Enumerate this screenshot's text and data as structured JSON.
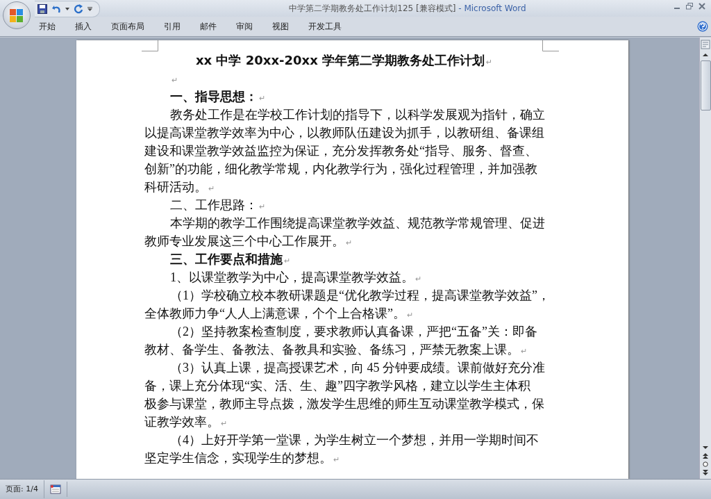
{
  "window": {
    "title_doc": "中学第二学期教务处工作计划125 [兼容模式]",
    "title_app": " - Microsoft Word"
  },
  "tabs": [
    {
      "label": "开始",
      "selected": false
    },
    {
      "label": "插入",
      "selected": false
    },
    {
      "label": "页面布局",
      "selected": false
    },
    {
      "label": "引用",
      "selected": false
    },
    {
      "label": "邮件",
      "selected": false
    },
    {
      "label": "审阅",
      "selected": false
    },
    {
      "label": "视图",
      "selected": false
    },
    {
      "label": "开发工具",
      "selected": false
    }
  ],
  "document": {
    "paragraphs": [
      {
        "kind": "title",
        "lines": [
          "xx 中学 20xx-20xx 学年第二学期教务处工作计划"
        ],
        "mark": "↵"
      },
      {
        "kind": "blank",
        "mark": "↵"
      },
      {
        "kind": "heading",
        "lines": [
          "一、指导思想："
        ],
        "mark": "↵"
      },
      {
        "kind": "body",
        "lines": [
          "教务处工作是在学校工作计划的指导下，以科学发展观为指针，确立",
          "以提高课堂教学效率为中心，以教师队伍建设为抓手，以教研组、备课组",
          "建设和课堂教学效益监控为保证，充分发挥教务处“指导、服务、督查、",
          "创新”的功能，细化教学常规，内化教学行为，强化过程管理，并加强教",
          "科研活动。"
        ],
        "mark": "↵"
      },
      {
        "kind": "body",
        "lines": [
          "二、工作思路："
        ],
        "mark": "↵"
      },
      {
        "kind": "body",
        "lines": [
          "本学期的教学工作围绕提高课堂教学效益、规范教学常规管理、促进",
          "教师专业发展这三个中心工作展开。"
        ],
        "mark": "↵"
      },
      {
        "kind": "heading",
        "lines": [
          "三、工作要点和措施"
        ],
        "mark": "↵"
      },
      {
        "kind": "body",
        "lines": [
          "1、以课堂教学为中心，提高课堂教学效益。"
        ],
        "mark": "↵"
      },
      {
        "kind": "body",
        "lines": [
          "（1）学校确立校本教研课题是“优化教学过程，提高课堂教学效益”，",
          "全体教师力争“人人上满意课，个个上合格课”。"
        ],
        "mark": "↵"
      },
      {
        "kind": "body",
        "lines": [
          "（2）坚持教案检查制度，要求教师认真备课，严把“五备”关：即备",
          "教材、备学生、备教法、备教具和实验、备练习，严禁无教案上课。"
        ],
        "mark": "↵"
      },
      {
        "kind": "body",
        "lines": [
          "（3）认真上课，提高授课艺术，向 45 分钟要成绩。课前做好充分准",
          "备，课上充分体现“实、活、生、趣”四字教学风格，建立以学生主体积",
          "极参与课堂，教师主导点拨，激发学生思维的师生互动课堂教学模式，保",
          "证教学效率。"
        ],
        "mark": "↵"
      },
      {
        "kind": "body",
        "lines": [
          "（4）上好开学第一堂课，为学生树立一个梦想，并用一学期时间不",
          "坚定学生信念，实现学生的梦想。"
        ],
        "mark": "↵"
      }
    ]
  },
  "status_bar": {
    "page": "页面: 1/4"
  }
}
